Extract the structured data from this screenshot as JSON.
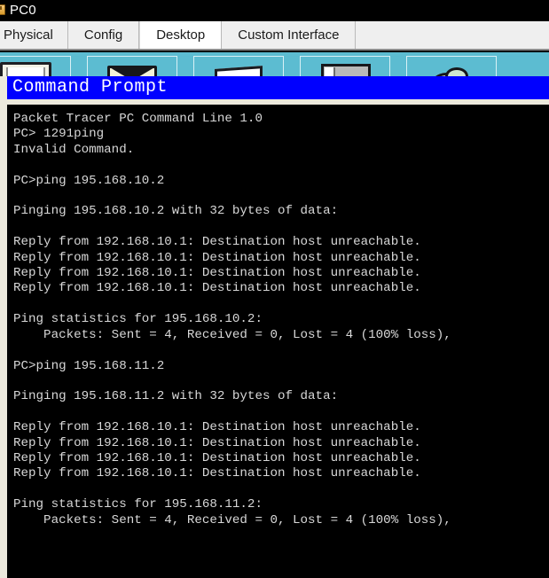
{
  "window": {
    "title": "PC0",
    "icon": "packet-tracer-device-icon"
  },
  "tabs": [
    {
      "label": "Physical",
      "active": false
    },
    {
      "label": "Config",
      "active": false
    },
    {
      "label": "Desktop",
      "active": true
    },
    {
      "label": "Custom Interface",
      "active": false
    }
  ],
  "desktop_icons": [
    {
      "name": "ip-configuration-icon",
      "shape": "monitor"
    },
    {
      "name": "dial-up-icon",
      "shape": "page"
    },
    {
      "name": "terminal-icon",
      "shape": "doc"
    },
    {
      "name": "command-prompt-icon",
      "shape": "window"
    },
    {
      "name": "web-browser-icon",
      "shape": "cloud"
    }
  ],
  "command_prompt": {
    "title": "Command Prompt",
    "title_bg": "#0000FF",
    "title_fg": "#FFFFFF",
    "terminal_bg": "#000000",
    "terminal_fg": "#D8D8D8",
    "lines": [
      "Packet Tracer PC Command Line 1.0",
      "PC> 1291ping",
      "Invalid Command.",
      "",
      "PC>ping 195.168.10.2",
      "",
      "Pinging 195.168.10.2 with 32 bytes of data:",
      "",
      "Reply from 192.168.10.1: Destination host unreachable.",
      "Reply from 192.168.10.1: Destination host unreachable.",
      "Reply from 192.168.10.1: Destination host unreachable.",
      "Reply from 192.168.10.1: Destination host unreachable.",
      "",
      "Ping statistics for 195.168.10.2:",
      "    Packets: Sent = 4, Received = 0, Lost = 4 (100% loss),",
      "",
      "PC>ping 195.168.11.2",
      "",
      "Pinging 195.168.11.2 with 32 bytes of data:",
      "",
      "Reply from 192.168.10.1: Destination host unreachable.",
      "Reply from 192.168.10.1: Destination host unreachable.",
      "Reply from 192.168.10.1: Destination host unreachable.",
      "Reply from 192.168.10.1: Destination host unreachable.",
      "",
      "Ping statistics for 195.168.11.2:",
      "    Packets: Sent = 4, Received = 0, Lost = 4 (100% loss),"
    ]
  }
}
